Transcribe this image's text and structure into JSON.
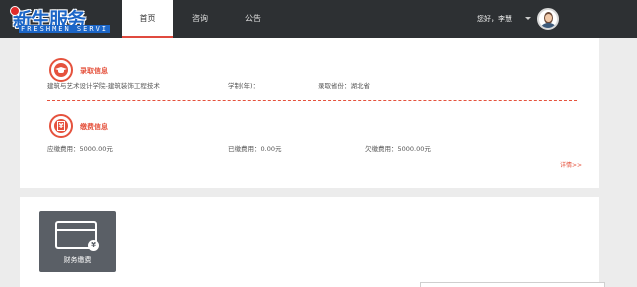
{
  "logo": {
    "main": "新生服务",
    "sub": "FRESHMEN SERVI"
  },
  "nav": {
    "home": "首页",
    "consult": "咨询",
    "notice": "公告"
  },
  "user": {
    "greeting": "您好，李慧"
  },
  "admission": {
    "title": "录取信息",
    "major": "建筑与艺术设计学院-建筑装饰工程技术",
    "duration": "学制(年)：",
    "province": "录取省份：湖北省"
  },
  "payment": {
    "title": "缴费信息",
    "due": "应缴费用：5000.00元",
    "paid": "已缴费用：0.00元",
    "owed": "欠缴费用：5000.00元",
    "more": "详情>>"
  },
  "tiles": [
    {
      "label": "财务缴费",
      "icon": "credit-card-icon"
    }
  ],
  "colors": {
    "accent": "#e5523d",
    "navbar": "#2d3033",
    "tile": "#5a5f66",
    "logo": "#1c66c7"
  }
}
